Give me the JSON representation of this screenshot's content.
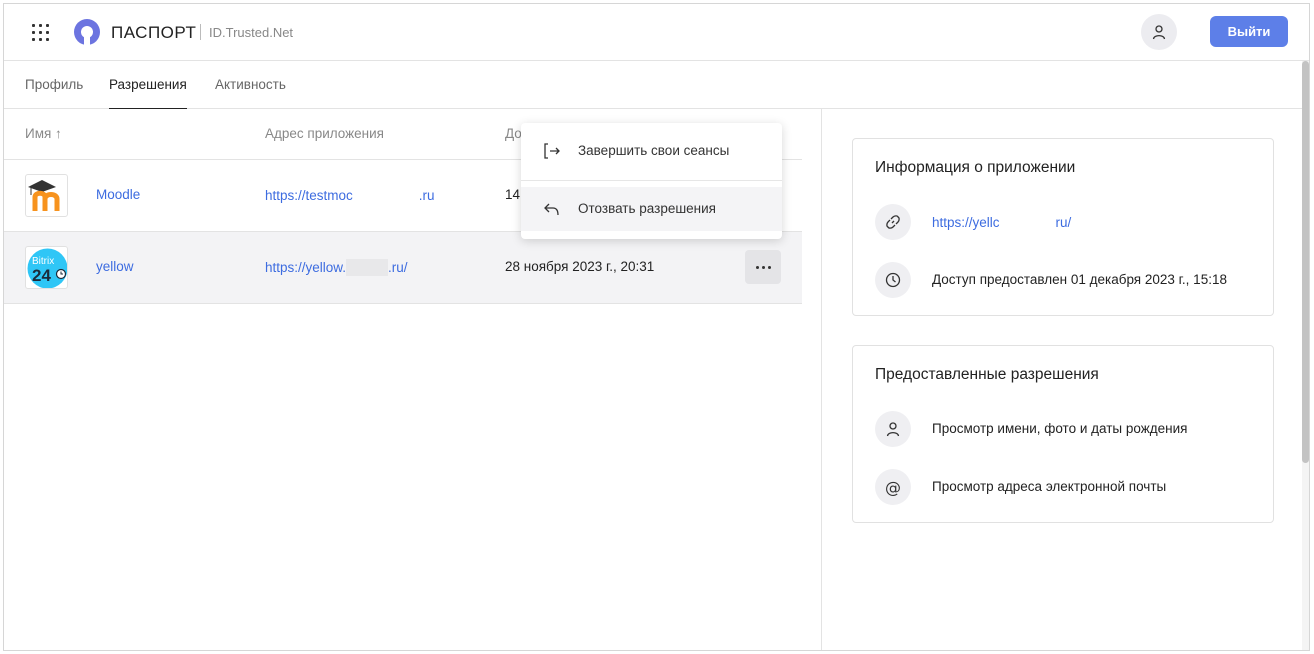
{
  "header": {
    "brand": "ПАСПОРТ",
    "brand_sub": "ID.Trusted.Net",
    "logout_label": "Выйти"
  },
  "tabs": [
    {
      "label": "Профиль",
      "active": false
    },
    {
      "label": "Разрешения",
      "active": true
    },
    {
      "label": "Активность",
      "active": false
    }
  ],
  "table": {
    "columns": [
      "Имя ↑",
      "Адрес приложения",
      "До"
    ],
    "rows": [
      {
        "name": "Moodle",
        "url_start": "https://testmoc",
        "url_end": ".ru",
        "date": "14",
        "icon": "moodle-logo"
      },
      {
        "name": "yellow",
        "url_start": "https://yellow.",
        "url_end": ".ru/",
        "date": "28 ноября 2023 г., 20:31",
        "icon": "bitrix24-logo",
        "icon_text_top": "Bitrix",
        "icon_text_bottom": "24"
      }
    ]
  },
  "menu": {
    "items": [
      {
        "label": "Завершить свои сеансы",
        "icon": "logout-arrow-icon"
      },
      {
        "label": "Отозвать разрешения",
        "icon": "undo-arrow-icon"
      }
    ]
  },
  "app_info": {
    "title": "Информация о приложении",
    "url_start": "https://yellc",
    "url_end": "ru/",
    "access_text": "Доступ предоставлен 01 декабря 2023 г., 15:18"
  },
  "permissions": {
    "title": "Предоставленные разрешения",
    "items": [
      {
        "label": "Просмотр имени, фото и даты рождения",
        "icon": "user-icon"
      },
      {
        "label": "Просмотр адреса электронной почты",
        "icon": "at-sign-icon"
      }
    ]
  },
  "colors": {
    "accent": "#5d7fe8",
    "link": "#3d6ce0",
    "logo": "#6c74e0"
  }
}
